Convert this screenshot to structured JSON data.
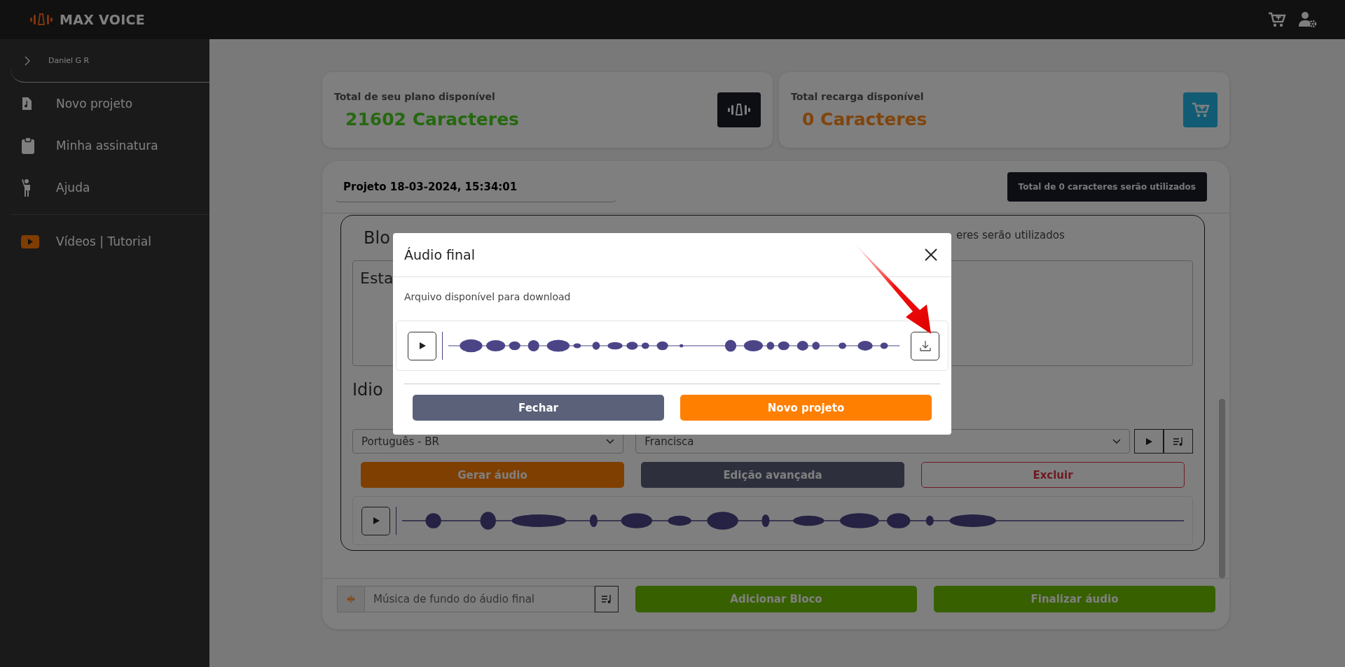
{
  "app": {
    "brand": "MAX VOICE"
  },
  "sidebar": {
    "user": "Daniel G R",
    "items": [
      {
        "label": "Novo projeto",
        "kind": "file"
      },
      {
        "label": "Minha assinatura",
        "kind": "clipboard"
      },
      {
        "label": "Ajuda",
        "kind": "person"
      }
    ],
    "extra_items": [
      {
        "label": "Vídeos | Tutorial",
        "kind": "video"
      }
    ]
  },
  "balance_cards": [
    {
      "title": "Total de seu plano disponível",
      "amount": "21602 Caracteres",
      "kind": "plan"
    },
    {
      "title": "Total recarga disponível",
      "amount": "0 Caracteres",
      "kind": "recharge"
    }
  ],
  "project": {
    "title": "Projeto 18-03-2024, 15:34:01",
    "usage": "Total de 0 caracteres serão utilizados",
    "block": {
      "heading": "Blo",
      "usage": "eres serão utilizados",
      "text": "Esta",
      "language_heading": "Idio",
      "language": "Português - BR",
      "voice": "Francisca",
      "actions": [
        {
          "label": "Gerar áudio",
          "kind": "primary"
        },
        {
          "label": "Edição avançada",
          "kind": "secondary"
        },
        {
          "label": "Excluir",
          "kind": "danger"
        }
      ]
    }
  },
  "bottom_bar": {
    "placeholder": "Música de fundo do áudio final",
    "actions": [
      {
        "label": "Adicionar Bloco"
      },
      {
        "label": "Finalizar áudio"
      }
    ]
  },
  "modal": {
    "title": "Áudio final",
    "message": "Arquivo disponível para download",
    "buttons": [
      {
        "label": "Fechar",
        "kind": "secondary"
      },
      {
        "label": "Novo projeto",
        "kind": "primary"
      }
    ]
  }
}
